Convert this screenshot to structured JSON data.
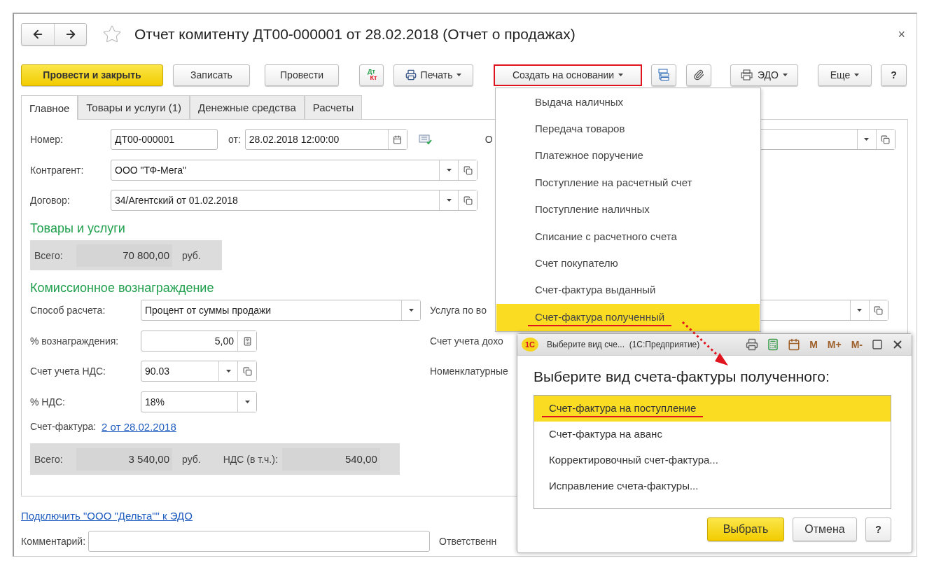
{
  "window": {
    "title": "Отчет комитенту ДТ00-000001 от 28.02.2018 (Отчет о продажах)",
    "close": "×",
    "starred": false
  },
  "toolbar": [
    {
      "kind": "primary",
      "label": "Провести и закрыть"
    },
    {
      "kind": "plain",
      "label": "Записать"
    },
    {
      "kind": "plain",
      "label": "Провести"
    },
    {
      "kind": "dtkt",
      "top": "Дт",
      "bottom": "Кт"
    },
    {
      "kind": "print-menu",
      "label": "Печать"
    },
    {
      "kind": "menu",
      "label": "Создать на основании",
      "highlighted": true
    },
    {
      "kind": "structure"
    },
    {
      "kind": "attach"
    },
    {
      "kind": "edo-menu",
      "label": "ЭДО"
    },
    {
      "kind": "menu",
      "label": "Еще"
    },
    {
      "kind": "help",
      "label": "?"
    }
  ],
  "tabs": [
    {
      "label": "Главное",
      "selected": true
    },
    {
      "label": "Товары и услуги (1)",
      "selected": false
    },
    {
      "label": "Денежные средства",
      "selected": false
    },
    {
      "label": "Расчеты",
      "selected": false
    }
  ],
  "header": {
    "number_label": "Номер:",
    "number": "ДТ00-000001",
    "date_label": "от:",
    "date": "28.02.2018 12:00:00",
    "org_label": "О",
    "counterparty_label": "Контрагент:",
    "counterparty": "ООО \"ТФ-Мега\"",
    "contract_label": "Договор:",
    "contract": "34/Агентский от 01.02.2018"
  },
  "goods": {
    "title": "Товары и услуги",
    "total_label": "Всего:",
    "total": "70 800,00",
    "currency": "руб."
  },
  "commission": {
    "title": "Комиссионное вознаграждение",
    "method_label": "Способ расчета:",
    "method": "Процент от суммы продажи",
    "service_label": "Услуга по во",
    "percent_label": "% вознаграждения:",
    "percent": "5,00",
    "income_label": "Счет учета дохо",
    "vat_account_label": "Счет учета НДС:",
    "vat_account": "90.03",
    "items_label": "Номенклатурные",
    "vat_rate_label": "% НДС:",
    "vat_rate": "18%",
    "invoice_label": "Счет-фактура:",
    "invoice_link": "2 от 28.02.2018",
    "total_label": "Всего:",
    "total": "3 540,00",
    "currency": "руб.",
    "vat_label": "НДС (в т.ч.):",
    "vat": "540,00"
  },
  "edo_link": "Подключить \"ООО \"Дельта\"\" к ЭДО",
  "comment_label": "Комментарий:",
  "responsible_label": "Ответственн",
  "create_menu": {
    "items": [
      {
        "label": "Выдача наличных",
        "selected": false
      },
      {
        "label": "Передача товаров",
        "selected": false
      },
      {
        "label": "Платежное поручение",
        "selected": false
      },
      {
        "label": "Поступление на расчетный счет",
        "selected": false
      },
      {
        "label": "Поступление наличных",
        "selected": false
      },
      {
        "label": "Списание с расчетного счета",
        "selected": false
      },
      {
        "label": "Счет покупателю",
        "selected": false
      },
      {
        "label": "Счет-фактура выданный",
        "selected": false
      },
      {
        "label": "Счет-фактура полученный",
        "selected": true
      }
    ]
  },
  "dialog": {
    "logo": "1С",
    "title": "Выберите вид сче...  (1С:Предприятие)",
    "memory_buttons": [
      "M",
      "M+",
      "M-"
    ],
    "heading": "Выберите вид счета-фактуры полученного:",
    "options": [
      {
        "label": "Счет-фактура на поступление",
        "selected": true
      },
      {
        "label": "Счет-фактура на аванс",
        "selected": false
      },
      {
        "label": "Корректировочный счет-фактура...",
        "selected": false
      },
      {
        "label": "Исправление счета-фактуры...",
        "selected": false
      }
    ],
    "buttons": [
      {
        "kind": "primary",
        "label": "Выбрать"
      },
      {
        "kind": "plain",
        "label": "Отмена"
      },
      {
        "kind": "help",
        "label": "?"
      }
    ]
  }
}
